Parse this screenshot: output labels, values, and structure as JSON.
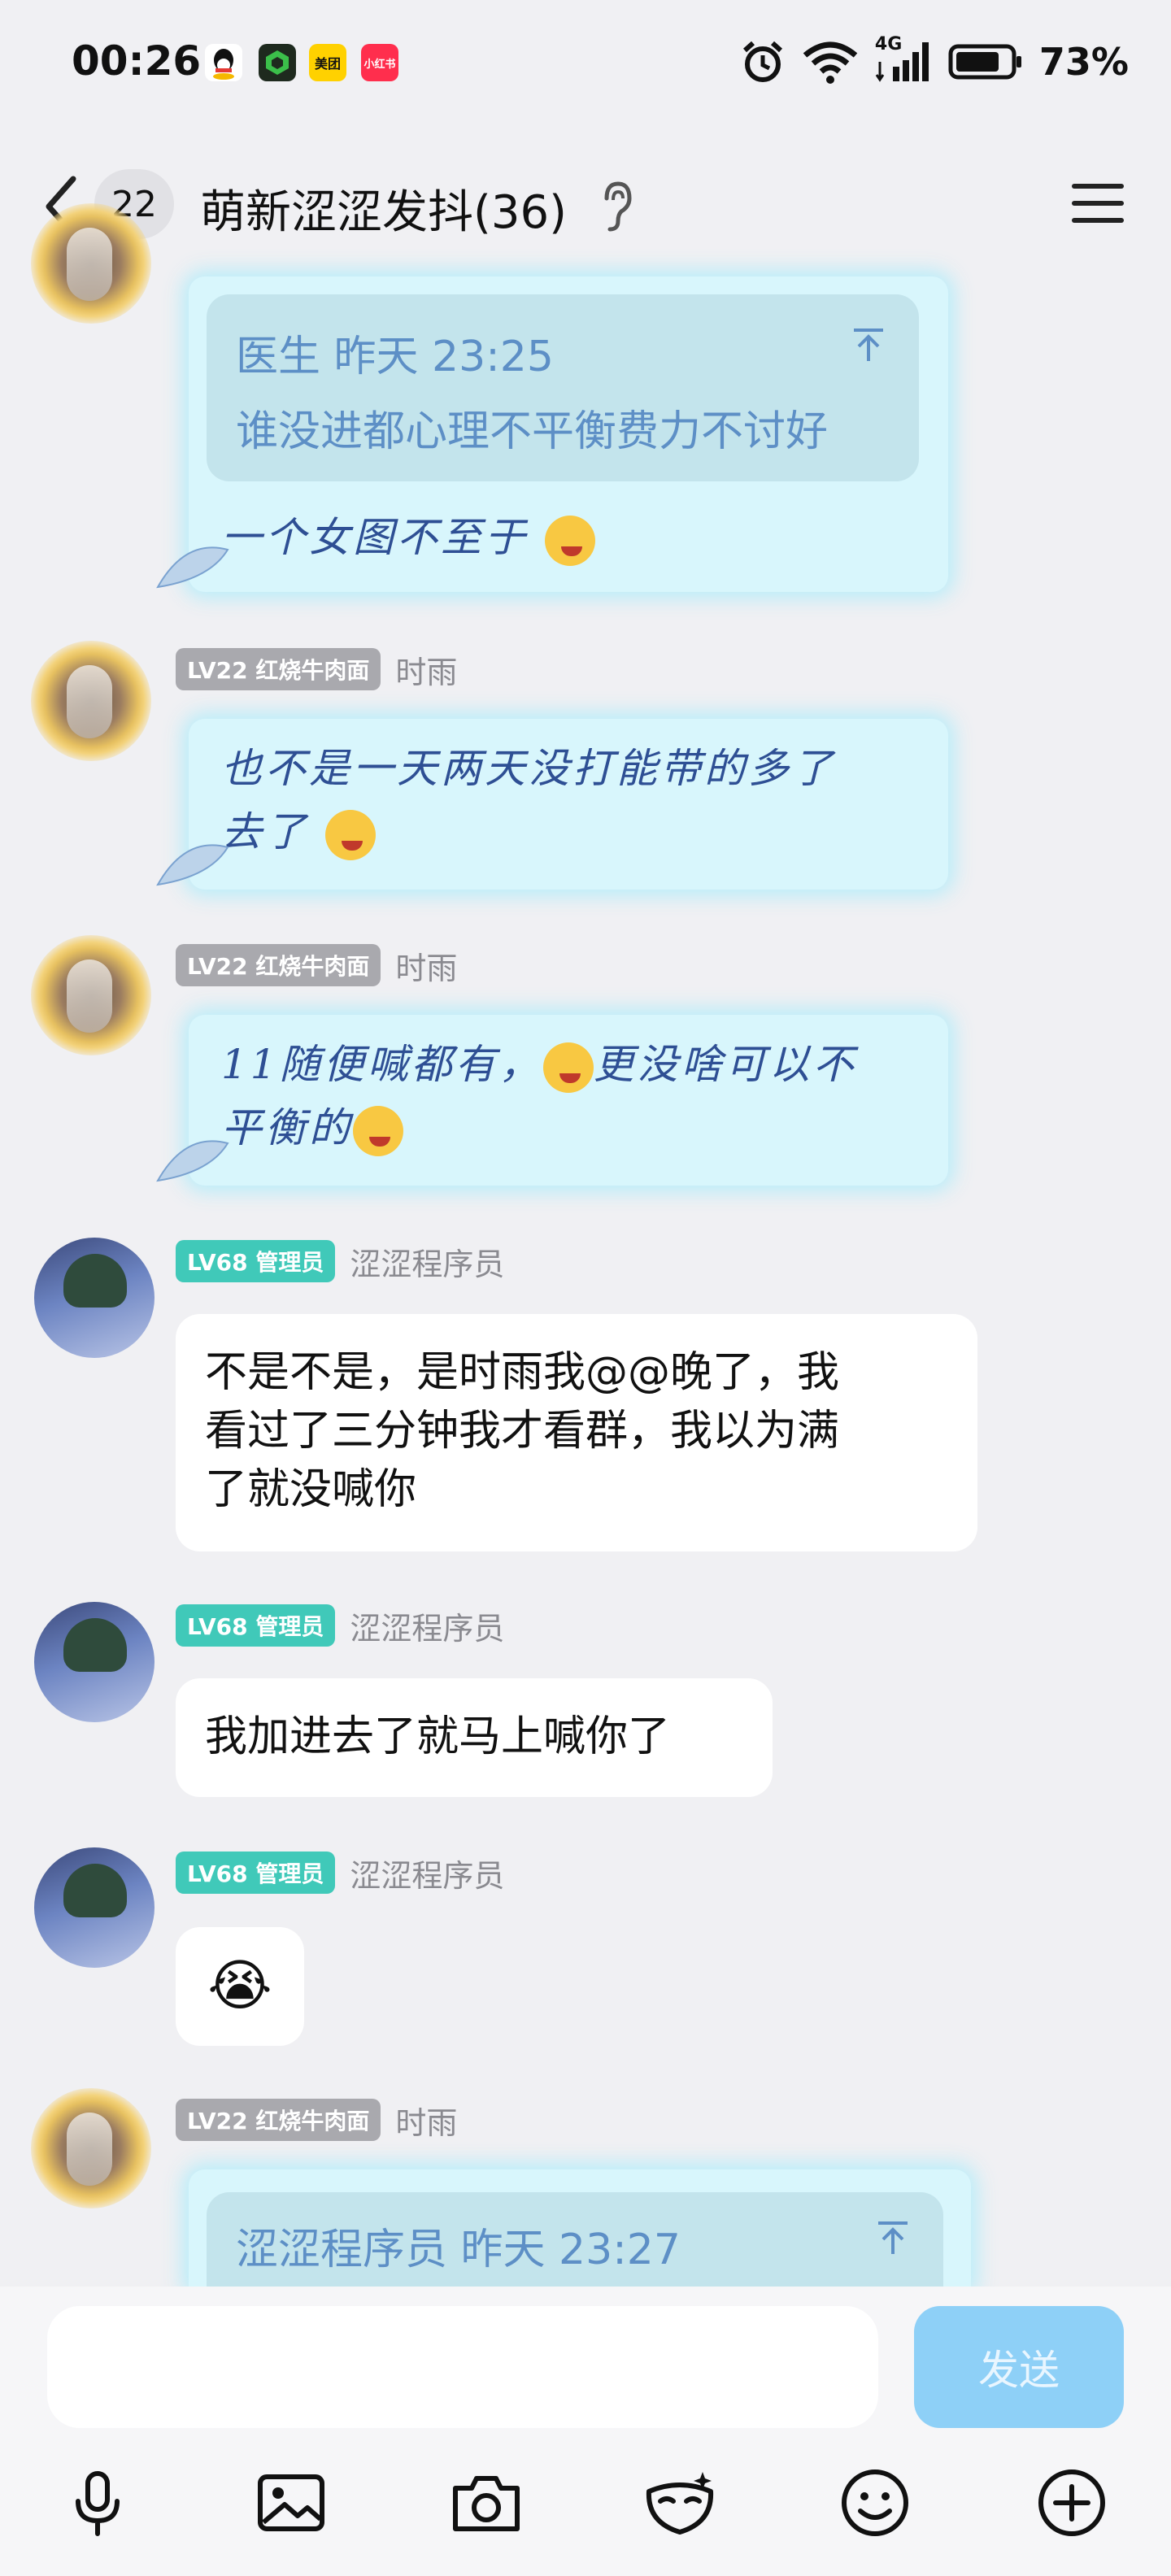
{
  "status_bar": {
    "time": "00:26",
    "apps": [
      "qq-icon",
      "green-app-icon",
      "美团",
      "小红书"
    ],
    "network": "4G",
    "battery": "73%"
  },
  "header": {
    "unread_count": "22",
    "title": "萌新涩涩发抖(36)"
  },
  "messages": [
    {
      "type": "cyan_quote_partial",
      "quote_sender_time": "医生  昨天 23:25",
      "quote_text": "谁没进都心理不平衡费力不讨好",
      "text": "一个女图不至于"
    },
    {
      "level": "LV22 红烧牛肉面",
      "sender": "时雨",
      "line1": "也不是一天两天没打能带的多了",
      "line2": "去了"
    },
    {
      "level": "LV22 红烧牛肉面",
      "sender": "时雨",
      "line1a": "11随便喊都有，",
      "line1b": "更没啥可以不",
      "line2": "平衡的"
    },
    {
      "level": "LV68 管理员",
      "sender": "涩涩程序员",
      "line1": "不是不是，是时雨我@@晚了，我",
      "line2": "看过了三分钟我才看群，我以为满",
      "line3": "了就没喊你"
    },
    {
      "level": "LV68 管理员",
      "sender": "涩涩程序员",
      "text": "我加进去了就马上喊你了"
    },
    {
      "level": "LV68 管理员",
      "sender": "涩涩程序员",
      "emoji": "😭"
    },
    {
      "level": "LV22 红烧牛肉面",
      "sender": "时雨",
      "quote_sender_time": "涩涩程序员  昨天 23:27"
    }
  ],
  "input": {
    "value": "",
    "send_label": "发送"
  },
  "toolbar": [
    "microphone-icon",
    "image-icon",
    "camera-icon",
    "mask-icon",
    "emoji-icon",
    "plus-icon"
  ]
}
